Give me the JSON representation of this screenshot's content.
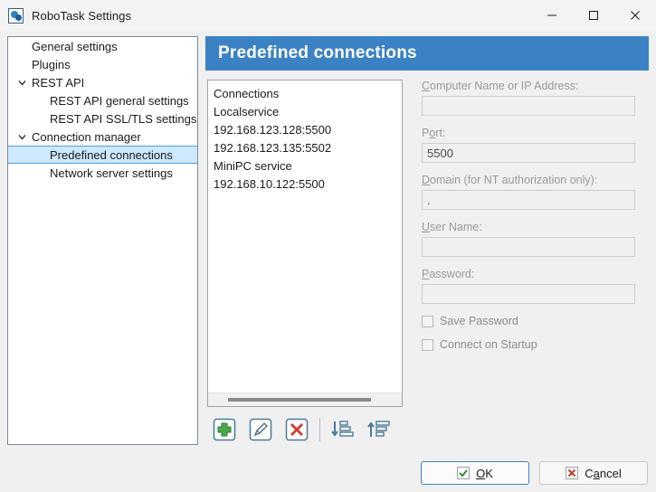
{
  "window": {
    "title": "RoboTask Settings",
    "icon": "robotask-gear-icon",
    "minimize_label": "—",
    "maximize_label": "□",
    "close_label": "✕"
  },
  "tree": {
    "items": [
      {
        "label": "General settings",
        "level": 1,
        "expander": "",
        "selected": false
      },
      {
        "label": "Plugins",
        "level": 1,
        "expander": "",
        "selected": false
      },
      {
        "label": "REST API",
        "level": 1,
        "expander": "chevron-down",
        "selected": false
      },
      {
        "label": "REST API general settings",
        "level": 2,
        "expander": "",
        "selected": false
      },
      {
        "label": "REST API SSL/TLS settings",
        "level": 2,
        "expander": "",
        "selected": false
      },
      {
        "label": "Connection manager",
        "level": 1,
        "expander": "chevron-down",
        "selected": false
      },
      {
        "label": "Predefined connections",
        "level": 2,
        "expander": "",
        "selected": true
      },
      {
        "label": "Network server settings",
        "level": 2,
        "expander": "",
        "selected": false
      }
    ]
  },
  "banner": {
    "title": "Predefined connections",
    "color": "#3b82c4"
  },
  "connections": {
    "root_label": "Connections",
    "items": [
      {
        "label": "Localservice",
        "type": "group"
      },
      {
        "label": "192.168.123.128:5500",
        "type": "address"
      },
      {
        "label": "192.168.123.135:5502",
        "type": "address"
      },
      {
        "label": "MiniPC service",
        "type": "group"
      },
      {
        "label": "192.168.10.122:5500",
        "type": "address"
      }
    ]
  },
  "toolbar": {
    "buttons": [
      {
        "name": "add-connection-button",
        "icon": "plus-icon"
      },
      {
        "name": "edit-connection-button",
        "icon": "pencil-icon"
      },
      {
        "name": "delete-connection-button",
        "icon": "delete-x-icon"
      },
      {
        "name": "sort-descending-button",
        "icon": "sort-descending-icon"
      },
      {
        "name": "sort-ascending-button",
        "icon": "sort-ascending-icon"
      }
    ]
  },
  "form": {
    "computer": {
      "label_accel": "C",
      "label_rest": "omputer Name or IP Address:",
      "value": ""
    },
    "port": {
      "label_accel": "o",
      "label_pre": "P",
      "label_rest": "rt:",
      "value": "5500"
    },
    "domain": {
      "label_accel": "D",
      "label_rest": "omain (for NT authorization only):",
      "value": "."
    },
    "username": {
      "label_accel": "U",
      "label_rest": "ser Name:",
      "value": ""
    },
    "password": {
      "label_accel": "P",
      "label_rest": "assword:",
      "value": ""
    },
    "save_password": {
      "label": "Save Password",
      "checked": false
    },
    "connect_startup": {
      "label": "Connect on Startup",
      "checked": false
    }
  },
  "footer": {
    "ok": {
      "accel": "O",
      "rest": "K",
      "icon": "green-check-icon"
    },
    "cancel": {
      "pre": "C",
      "accel": "a",
      "rest": "ncel",
      "icon": "red-x-icon"
    }
  }
}
